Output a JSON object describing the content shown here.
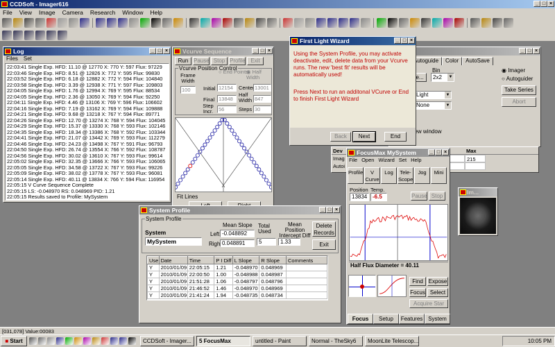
{
  "app": {
    "title": "CCDSoft - Imager616",
    "menus": [
      "File",
      "View",
      "Image",
      "Camera",
      "Research",
      "Window",
      "Help"
    ]
  },
  "statusbar": {
    "text": "[031,078] Value:00083"
  },
  "log": {
    "title": "Log",
    "menus": [
      "Files",
      "Set"
    ],
    "lines": [
      "22:03:41  Single Exp. HFD: 11.10 @ 12770 X: 770 Y: 597 Flux: 97229",
      "22:03:46  Single Exp. HFD:  8.51 @ 12826 X: 772 Y: 595 Flux: 99830",
      "22:03:52  Single Exp. HFD:  6.18 @ 12882 X: 772 Y: 594 Flux: 104840",
      "22:03:58  Single Exp. HFD:  3.39 @ 12938 X: 771 Y: 597 Flux: 109803",
      "22:04:05  Single Exp. HFD:  1.76 @ 12994 X: 769 Y: 595 Flux: 88534",
      "22:04:05  Single Exp. HFD:  2.36 @ 13050 X: 769 Y: 594 Flux: 92250",
      "22:04:11  Single Exp. HFD:  4.46 @ 13106 X: 769 Y: 596 Flux: 106602",
      "22:04:16  Single Exp. HFD:  7.19 @ 13162 X: 769 Y: 594 Flux: 109888",
      "22:04:21  Single Exp. HFD:  9.68 @ 13218 X: 767 Y: 594 Flux: 89771",
      "22:04:26  Single Exp. HFD: 12.70 @ 13274 X: 768 Y: 594 Flux: 104045",
      "22:04:29  Single Exp. HFD: 15.37 @ 13330 X: 768 Y: 593 Flux: 102146",
      "22:04:35  Single Exp. HFD: 18.34 @ 13386 X: 768 Y: 592 Flux: 103344",
      "22:04:41  Single Exp. HFD: 21.07 @ 13442 X: 769 Y: 593 Flux: 112279",
      "22:04:46  Single Exp. HFD: 24.23 @ 13498 X: 767 Y: 591 Flux: 96793",
      "22:04:50  Single Exp. HFD: 26.74 @ 13554 X: 766 Y: 592 Flux: 108787",
      "22:04:56  Single Exp. HFD: 30.02 @ 13610 X: 767 Y: 593 Flux: 99614",
      "22:05:02  Single Exp. HFD: 32.35 @ 13666 X: 766 Y: 593 Flux: 106065",
      "22:05:05  Single Exp. HFD: 34.58 @ 13722 X: 767 Y: 593 Flux: 99226",
      "22:05:09  Single Exp. HFD: 38.02 @ 13778 X: 767 Y: 593 Flux: 96081",
      "22:05:14  Single Exp. HFD: 40.11 @ 13834 X: 766 Y: 594 Flux: 116954",
      "22:05:15  V Curve Sequence Complete",
      "22:05:15  LS: -0.048970 RS: 0.048969 PID: 1.21",
      "22:05:15  Results saved to Profile: MySystem"
    ]
  },
  "vcurve": {
    "title": "Vcurve Sequence",
    "buttons": [
      "Run",
      "Pause",
      "Stop",
      "Profile",
      "Exit"
    ],
    "group": "Vcurve Position Control",
    "frame_width_label": "Frame Width",
    "frame_width": "100",
    "initial_label": "Initial",
    "initial": "12154",
    "center_label": "Center",
    "center": "13001",
    "end_points_label": "End Points",
    "half_width_radio": "Half Width",
    "final_label": "Final",
    "final": "13848",
    "half_width_label": "Half Width",
    "half_width": "847",
    "step_label": "Step Incr.",
    "step": "56",
    "steps_label": "Steps",
    "steps": "30",
    "fit_lines": "Fit Lines",
    "left": "Left",
    "right": "Right"
  },
  "wizard": {
    "title": "First Light Wizard",
    "para1": "Using the System Profile, you may activate deactivate, edit, delete data from your Vcurve runs. The new 'best fit' results will be automatically used!",
    "para2": "Press Next to run an additonal VCurve or End to finish First Light Wizard",
    "back": "Back",
    "next": "Next",
    "end": "End"
  },
  "camera": {
    "tabs": [
      "Autoguide",
      "Color",
      "AutoSave"
    ],
    "bin_label": "Bin",
    "bin": "2x2",
    "radio_imager": "Imager",
    "radio_autoguider": "Autoguider",
    "take_series": "Take Series",
    "abort": "Abort",
    "size_btn": "ze...",
    "light": "Light",
    "none": "None",
    "new_window": "new window"
  },
  "device": {
    "header": [
      "Dev",
      "Temperature",
      "Shutter",
      "Filter",
      "Max"
    ],
    "rows": [
      [
        "Imag",
        "-29.7° (39%)",
        "Closed",
        "",
        "215"
      ],
      [
        "Autoi",
        "-29.7° (39%)",
        "Closed",
        "",
        ""
      ]
    ]
  },
  "focusmax": {
    "title": "FocusMax   MySystem",
    "menus": [
      "File",
      "Open",
      "Wizard",
      "Set",
      "Help"
    ],
    "buttons": [
      "Profile",
      "V Curve",
      "Log",
      "Tele-Scope",
      "Jog",
      "Mini"
    ],
    "position_label": "Position",
    "temp_label": "Temp.",
    "position": "13834",
    "temp": "-6.5",
    "pause": "Pause",
    "stop": "Stop",
    "hfd": "Half Flux Diameter = 40.11",
    "find": "Find",
    "expose": "Expose",
    "focus": "Focus",
    "select": "Select",
    "acquire": "Acquire Star",
    "tabs": [
      "Focus",
      "Setup",
      "Features",
      "System"
    ]
  },
  "starwin": {
    "title": "Im..."
  },
  "profile": {
    "title": "System Profile",
    "group": "System Profile",
    "system_label": "System",
    "system": "MySystem",
    "mean_slope_label": "Mean Slope",
    "left_label": "Left",
    "left": "-0.048892",
    "right_label": "Right",
    "right": "0.048891",
    "total_used_label": "Total Used",
    "total_used": "5",
    "mpid_label": "Mean Position Intercept Diff",
    "mpid": "1.33",
    "delete": "Delete Records",
    "exit": "Exit",
    "columns": [
      "Use",
      "Date",
      "Time",
      "P I Diff",
      "L Slope",
      "R Slope",
      "Comments"
    ],
    "rows": [
      [
        "Y",
        "2010/01/09",
        "22:05:15",
        "1.21",
        "-0.048970",
        "0.048969",
        ""
      ],
      [
        "Y",
        "2010/01/09",
        "22:00:50",
        "1.00",
        "-0.048988",
        "0.048987",
        ""
      ],
      [
        "Y",
        "2010/01/09",
        "21:51:28",
        "1.06",
        "-0.048797",
        "0.048796",
        ""
      ],
      [
        "Y",
        "2010/01/09",
        "21:46:52",
        "1.46",
        "-0.048970",
        "0.048969",
        ""
      ],
      [
        "Y",
        "2010/01/09",
        "21:41:24",
        "1.94",
        "-0.048735",
        "0.048734",
        ""
      ]
    ]
  },
  "taskbar": {
    "start": "Start",
    "items": [
      "CCDSoft - Imager...",
      "5 FocusMax",
      "untitled - Paint",
      "Normal - TheSky6",
      "MoonLite Telescop..."
    ],
    "clock": "10:05 PM"
  },
  "icons": [
    "new-icon",
    "open-icon",
    "save-icon",
    "print-icon",
    "cut-icon",
    "copy-icon",
    "paste-icon",
    "up-arrow-icon",
    "down-arrow-icon",
    "left-arrow-icon",
    "right-arrow-icon",
    "crosshair-icon",
    "star-icon",
    "focus-icon",
    "settings-icon"
  ]
}
